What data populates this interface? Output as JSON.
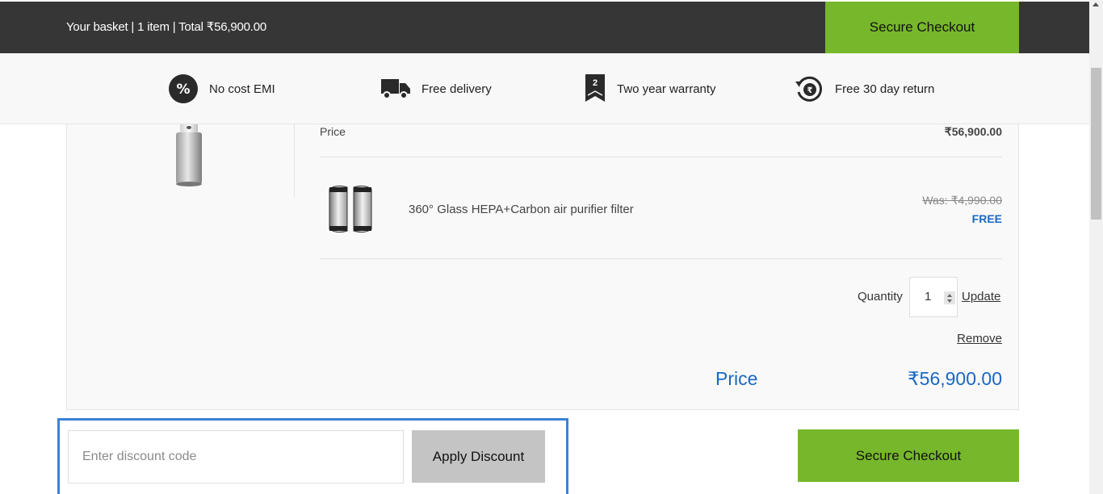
{
  "header": {
    "basket_summary": "Your basket | 1 item | Total ₹56,900.00",
    "checkout_label": "Secure Checkout"
  },
  "benefits": [
    {
      "label": "No cost EMI",
      "icon": "percent-icon"
    },
    {
      "label": "Free delivery",
      "icon": "truck-icon"
    },
    {
      "label": "Two year warranty",
      "icon": "warranty-badge-icon",
      "badge_number": "2"
    },
    {
      "label": "Free 30 day return",
      "icon": "return-rupee-icon"
    }
  ],
  "cart": {
    "price_label": "Price",
    "price_value": "₹56,900.00",
    "free_item": {
      "name": "360° Glass HEPA+Carbon air purifier filter",
      "was_price": "Was: ₹4,990.00",
      "free_label": "FREE"
    },
    "quantity_label": "Quantity",
    "quantity_value": "1",
    "update_label": "Update",
    "remove_label": "Remove",
    "total_label": "Price",
    "total_value": "₹56,900.00"
  },
  "discount": {
    "placeholder": "Enter discount code",
    "value": "",
    "apply_label": "Apply Discount"
  },
  "footer": {
    "checkout_label": "Secure Checkout"
  },
  "colors": {
    "accent_green": "#77b72b",
    "topbar_dark": "#363636",
    "price_blue": "#1a67c4",
    "focus_outline": "#3b82d4"
  }
}
